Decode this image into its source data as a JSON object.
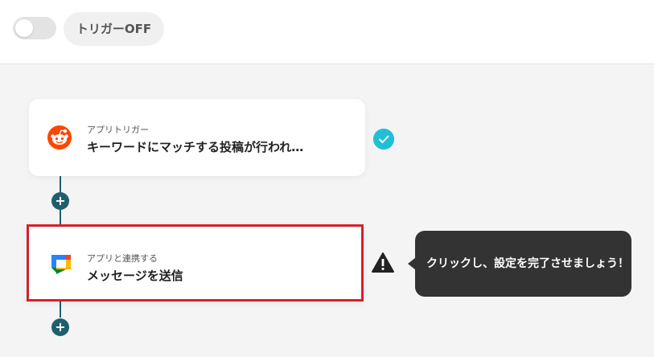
{
  "header": {
    "trigger_toggle_state": "off",
    "trigger_label": "トリガーOFF"
  },
  "flow": {
    "steps": [
      {
        "label": "アプリトリガー",
        "title": "キーワードにマッチする投稿が行われ…",
        "icon": "reddit-icon",
        "status": "complete"
      },
      {
        "label": "アプリと連携する",
        "title": "メッセージを送信",
        "icon": "google-chat-icon",
        "status": "warning"
      }
    ],
    "add_step_symbol": "+"
  },
  "tooltip": {
    "text": "クリックし、設定を完了させましょう！"
  },
  "colors": {
    "connector": "#1e5f6e",
    "check": "#1fbfd8",
    "highlight_border": "#d6202a",
    "tooltip_bg": "#333333"
  }
}
